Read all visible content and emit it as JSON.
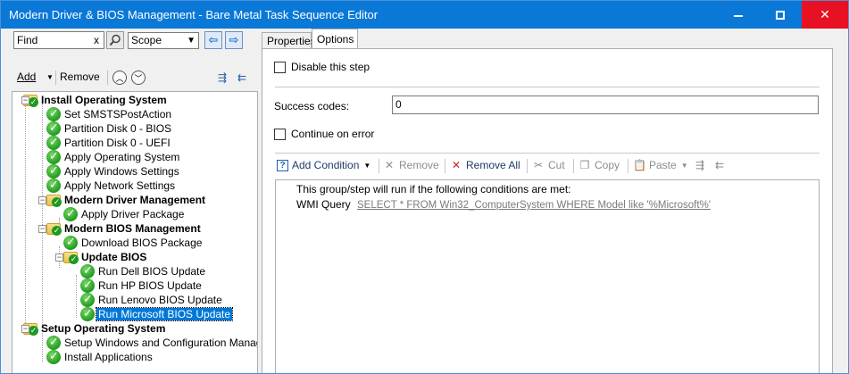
{
  "window": {
    "title": "Modern Driver & BIOS Management - Bare Metal Task Sequence Editor",
    "minimize_icon": "minimize-icon",
    "maximize_icon": "maximize-icon",
    "close_icon": "close-icon",
    "close_glyph": "✕",
    "title_bar_color": "#0a78d7",
    "close_color": "#e81123"
  },
  "left": {
    "find_value": "Find",
    "find_clear": "x",
    "scope_label": "Scope",
    "nav_back": "⇦",
    "nav_forward": "⇨",
    "toolbar": {
      "add": "Add",
      "remove": "Remove"
    },
    "tree": [
      {
        "label": "Install Operating System",
        "type": "group"
      },
      {
        "label": "Set SMSTSPostAction",
        "type": "step"
      },
      {
        "label": "Partition Disk 0 - BIOS",
        "type": "step"
      },
      {
        "label": "Partition Disk 0 - UEFI",
        "type": "step"
      },
      {
        "label": "Apply Operating System",
        "type": "step"
      },
      {
        "label": "Apply Windows Settings",
        "type": "step"
      },
      {
        "label": "Apply Network Settings",
        "type": "step"
      },
      {
        "label": "Modern Driver Management",
        "type": "group"
      },
      {
        "label": "Apply Driver Package",
        "type": "step"
      },
      {
        "label": "Modern BIOS Management",
        "type": "group"
      },
      {
        "label": "Download BIOS Package",
        "type": "step"
      },
      {
        "label": "Update BIOS",
        "type": "group"
      },
      {
        "label": "Run Dell BIOS Update",
        "type": "step"
      },
      {
        "label": "Run HP BIOS Update",
        "type": "step"
      },
      {
        "label": "Run Lenovo BIOS Update",
        "type": "step"
      },
      {
        "label": "Run Microsoft BIOS Update",
        "type": "step",
        "selected": true
      },
      {
        "label": "Setup Operating System",
        "type": "group"
      },
      {
        "label": "Setup Windows and Configuration Manager",
        "type": "step"
      },
      {
        "label": "Install Applications",
        "type": "step"
      }
    ]
  },
  "tabs": [
    {
      "label": "Properties",
      "active": false
    },
    {
      "label": "Options",
      "active": true
    }
  ],
  "options": {
    "disable_step_label": "Disable this step",
    "disable_step_checked": false,
    "success_codes_label": "Success codes:",
    "success_codes_value": "0",
    "continue_on_error_label": "Continue on error",
    "continue_on_error_checked": false,
    "toolbar": {
      "add_condition": "Add Condition",
      "remove": "Remove",
      "remove_all": "Remove All",
      "cut": "Cut",
      "copy": "Copy",
      "paste": "Paste"
    },
    "conditions_header": "This group/step will run if the following conditions are met:",
    "condition": {
      "type": "WMI Query",
      "query": "SELECT * FROM Win32_ComputerSystem WHERE Model like '%Microsoft%'"
    }
  }
}
